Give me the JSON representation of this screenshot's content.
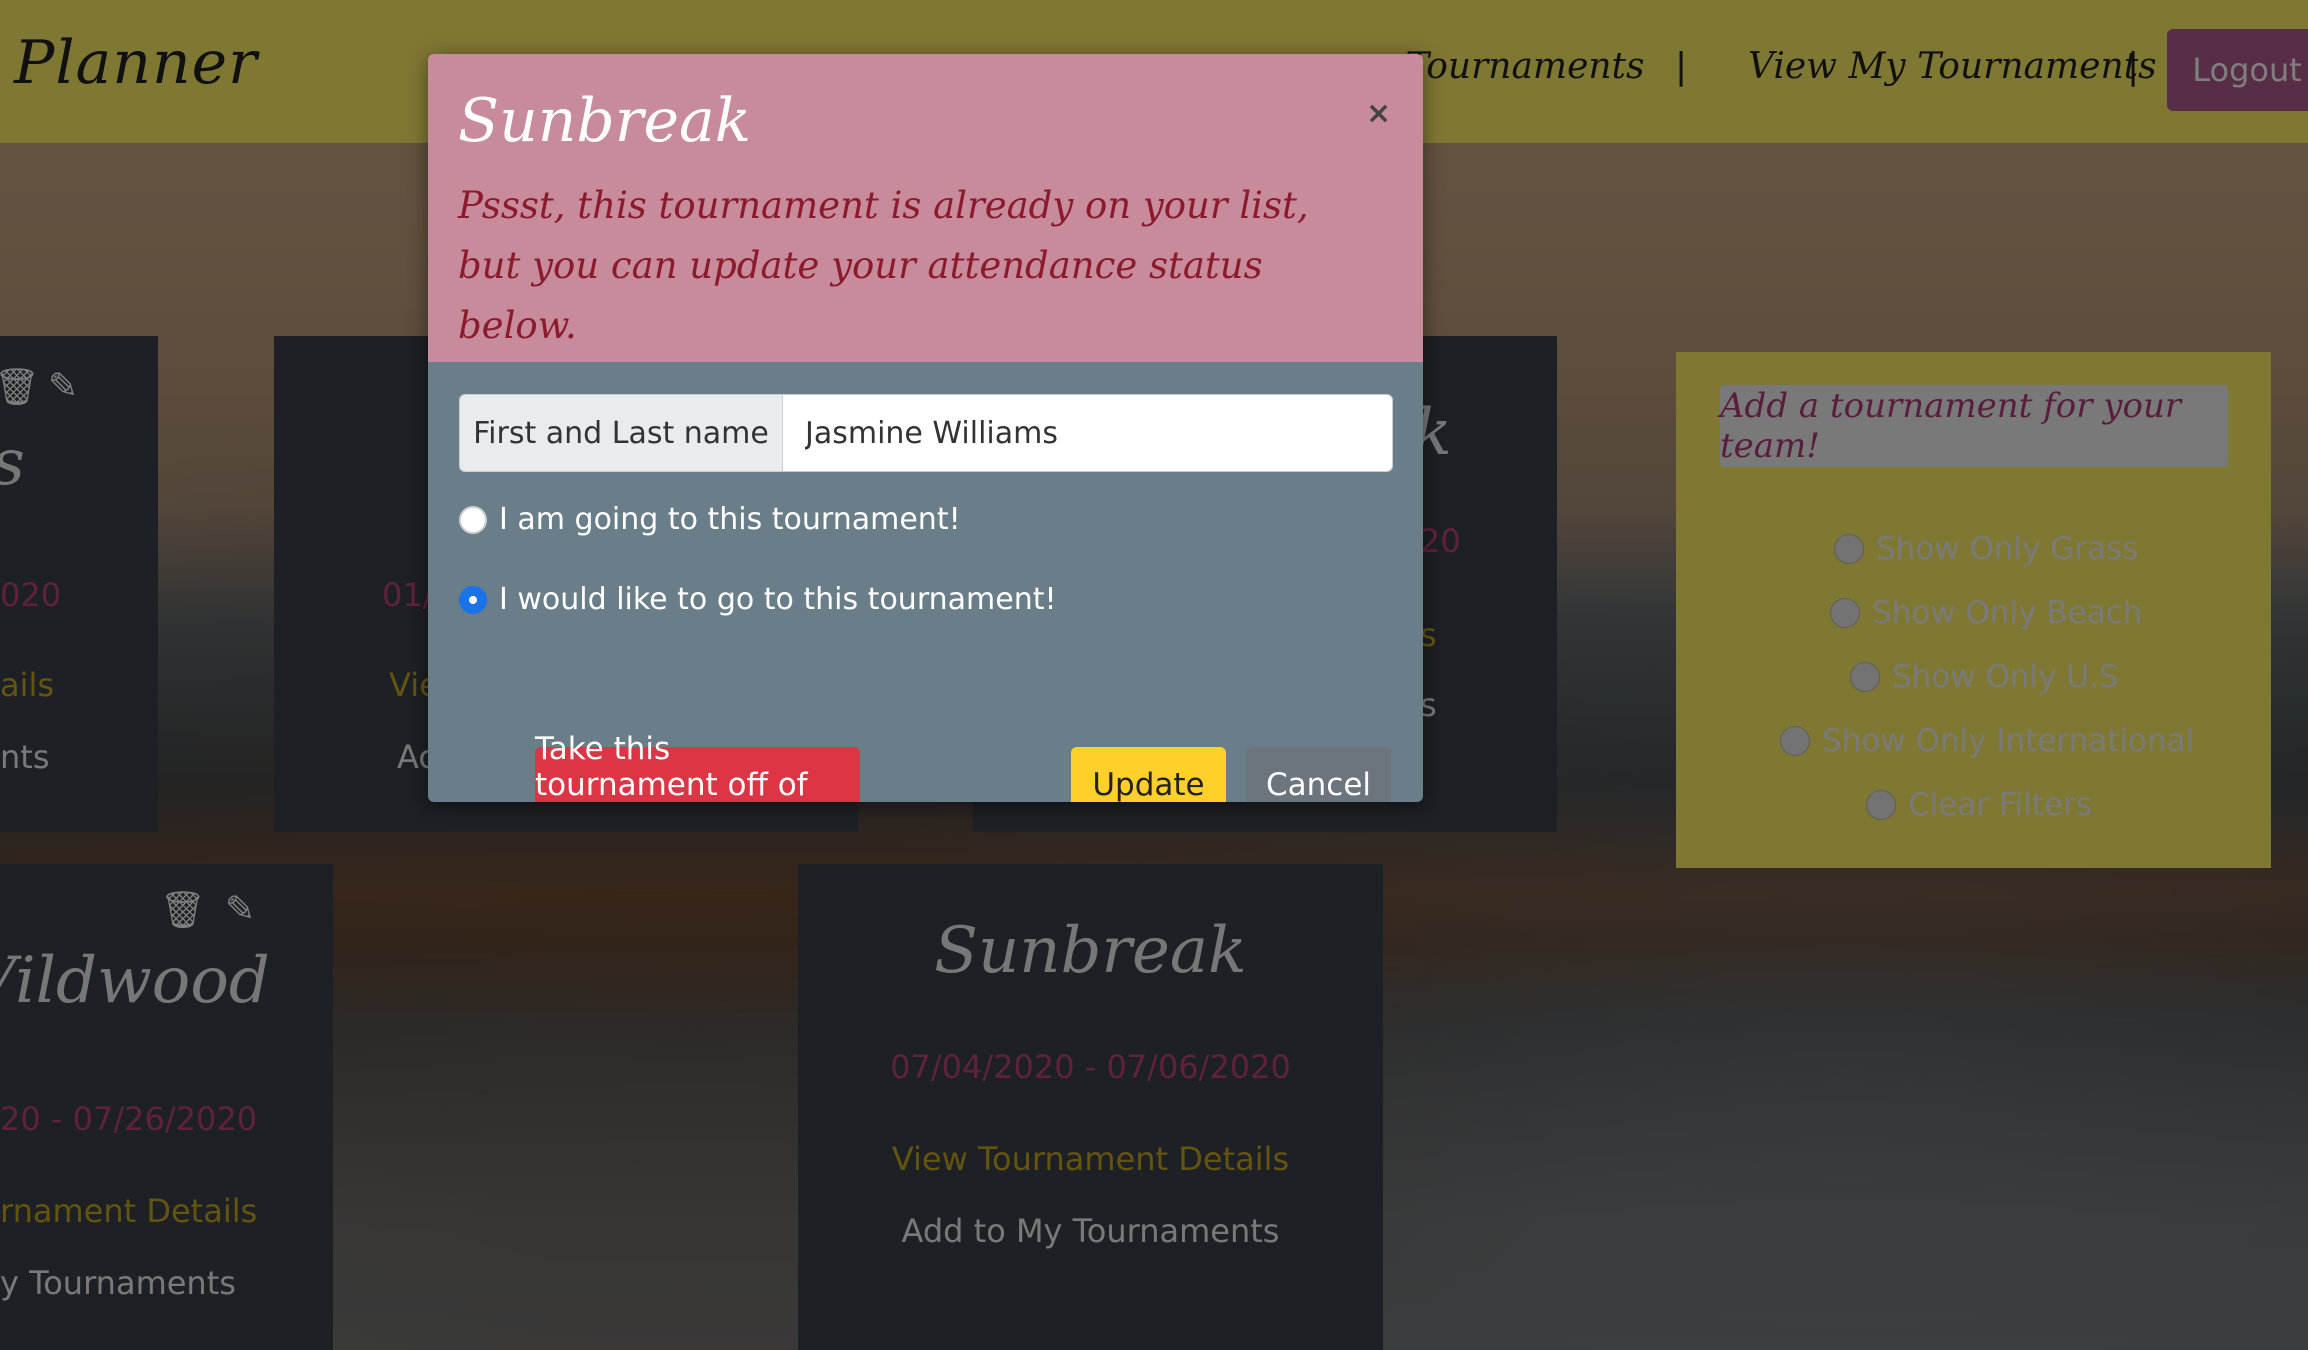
{
  "nav": {
    "brand": "Planner",
    "link_tournaments": "Tournaments",
    "separator": "|",
    "link_view_my": "View My Tournaments",
    "logout": "Logout"
  },
  "cards": {
    "left_top": {
      "title": "s",
      "dates": "020",
      "details": "ails",
      "add": "nts"
    },
    "mid_top": {
      "dates": "01/",
      "details": "Vie",
      "add": "Ac"
    },
    "right_top": {
      "title": "k",
      "dates": "20",
      "details": "s",
      "add": "s"
    },
    "bottom_left": {
      "title": "Vildwood",
      "dates": "20 - 07/26/2020",
      "details": "rnament Details",
      "add": "y Tournaments"
    },
    "bottom_center": {
      "title": "Sunbreak",
      "dates": "07/04/2020 - 07/06/2020",
      "details": "View Tournament Details",
      "add": "Add to My Tournaments"
    }
  },
  "filters": {
    "add_button": "Add a tournament for your team!",
    "options": [
      "Show Only Grass",
      "Show Only Beach",
      "Show Only U.S",
      "Show Only International",
      "Clear Filters"
    ]
  },
  "modal": {
    "title": "Sunbreak",
    "close": "×",
    "message": "Pssst, this tournament is already on your list, but you can update your attendance status below.",
    "name_label": "First and Last name",
    "name_value": "Jasmine Williams",
    "radio_going": "I am going to this tournament!",
    "radio_would_like": "I would like to go to this tournament!",
    "selected": "would_like",
    "btn_remove": "Take this tournament off of my list.",
    "btn_update": "Update",
    "btn_cancel": "Cancel"
  },
  "colors": {
    "nav_bg": "#fff067",
    "modal_header": "#c78b9c",
    "modal_body": "#6a7e8a",
    "danger": "#dc3545",
    "warning": "#ffd02a"
  },
  "icons": [
    "trash-icon",
    "edit-icon"
  ]
}
